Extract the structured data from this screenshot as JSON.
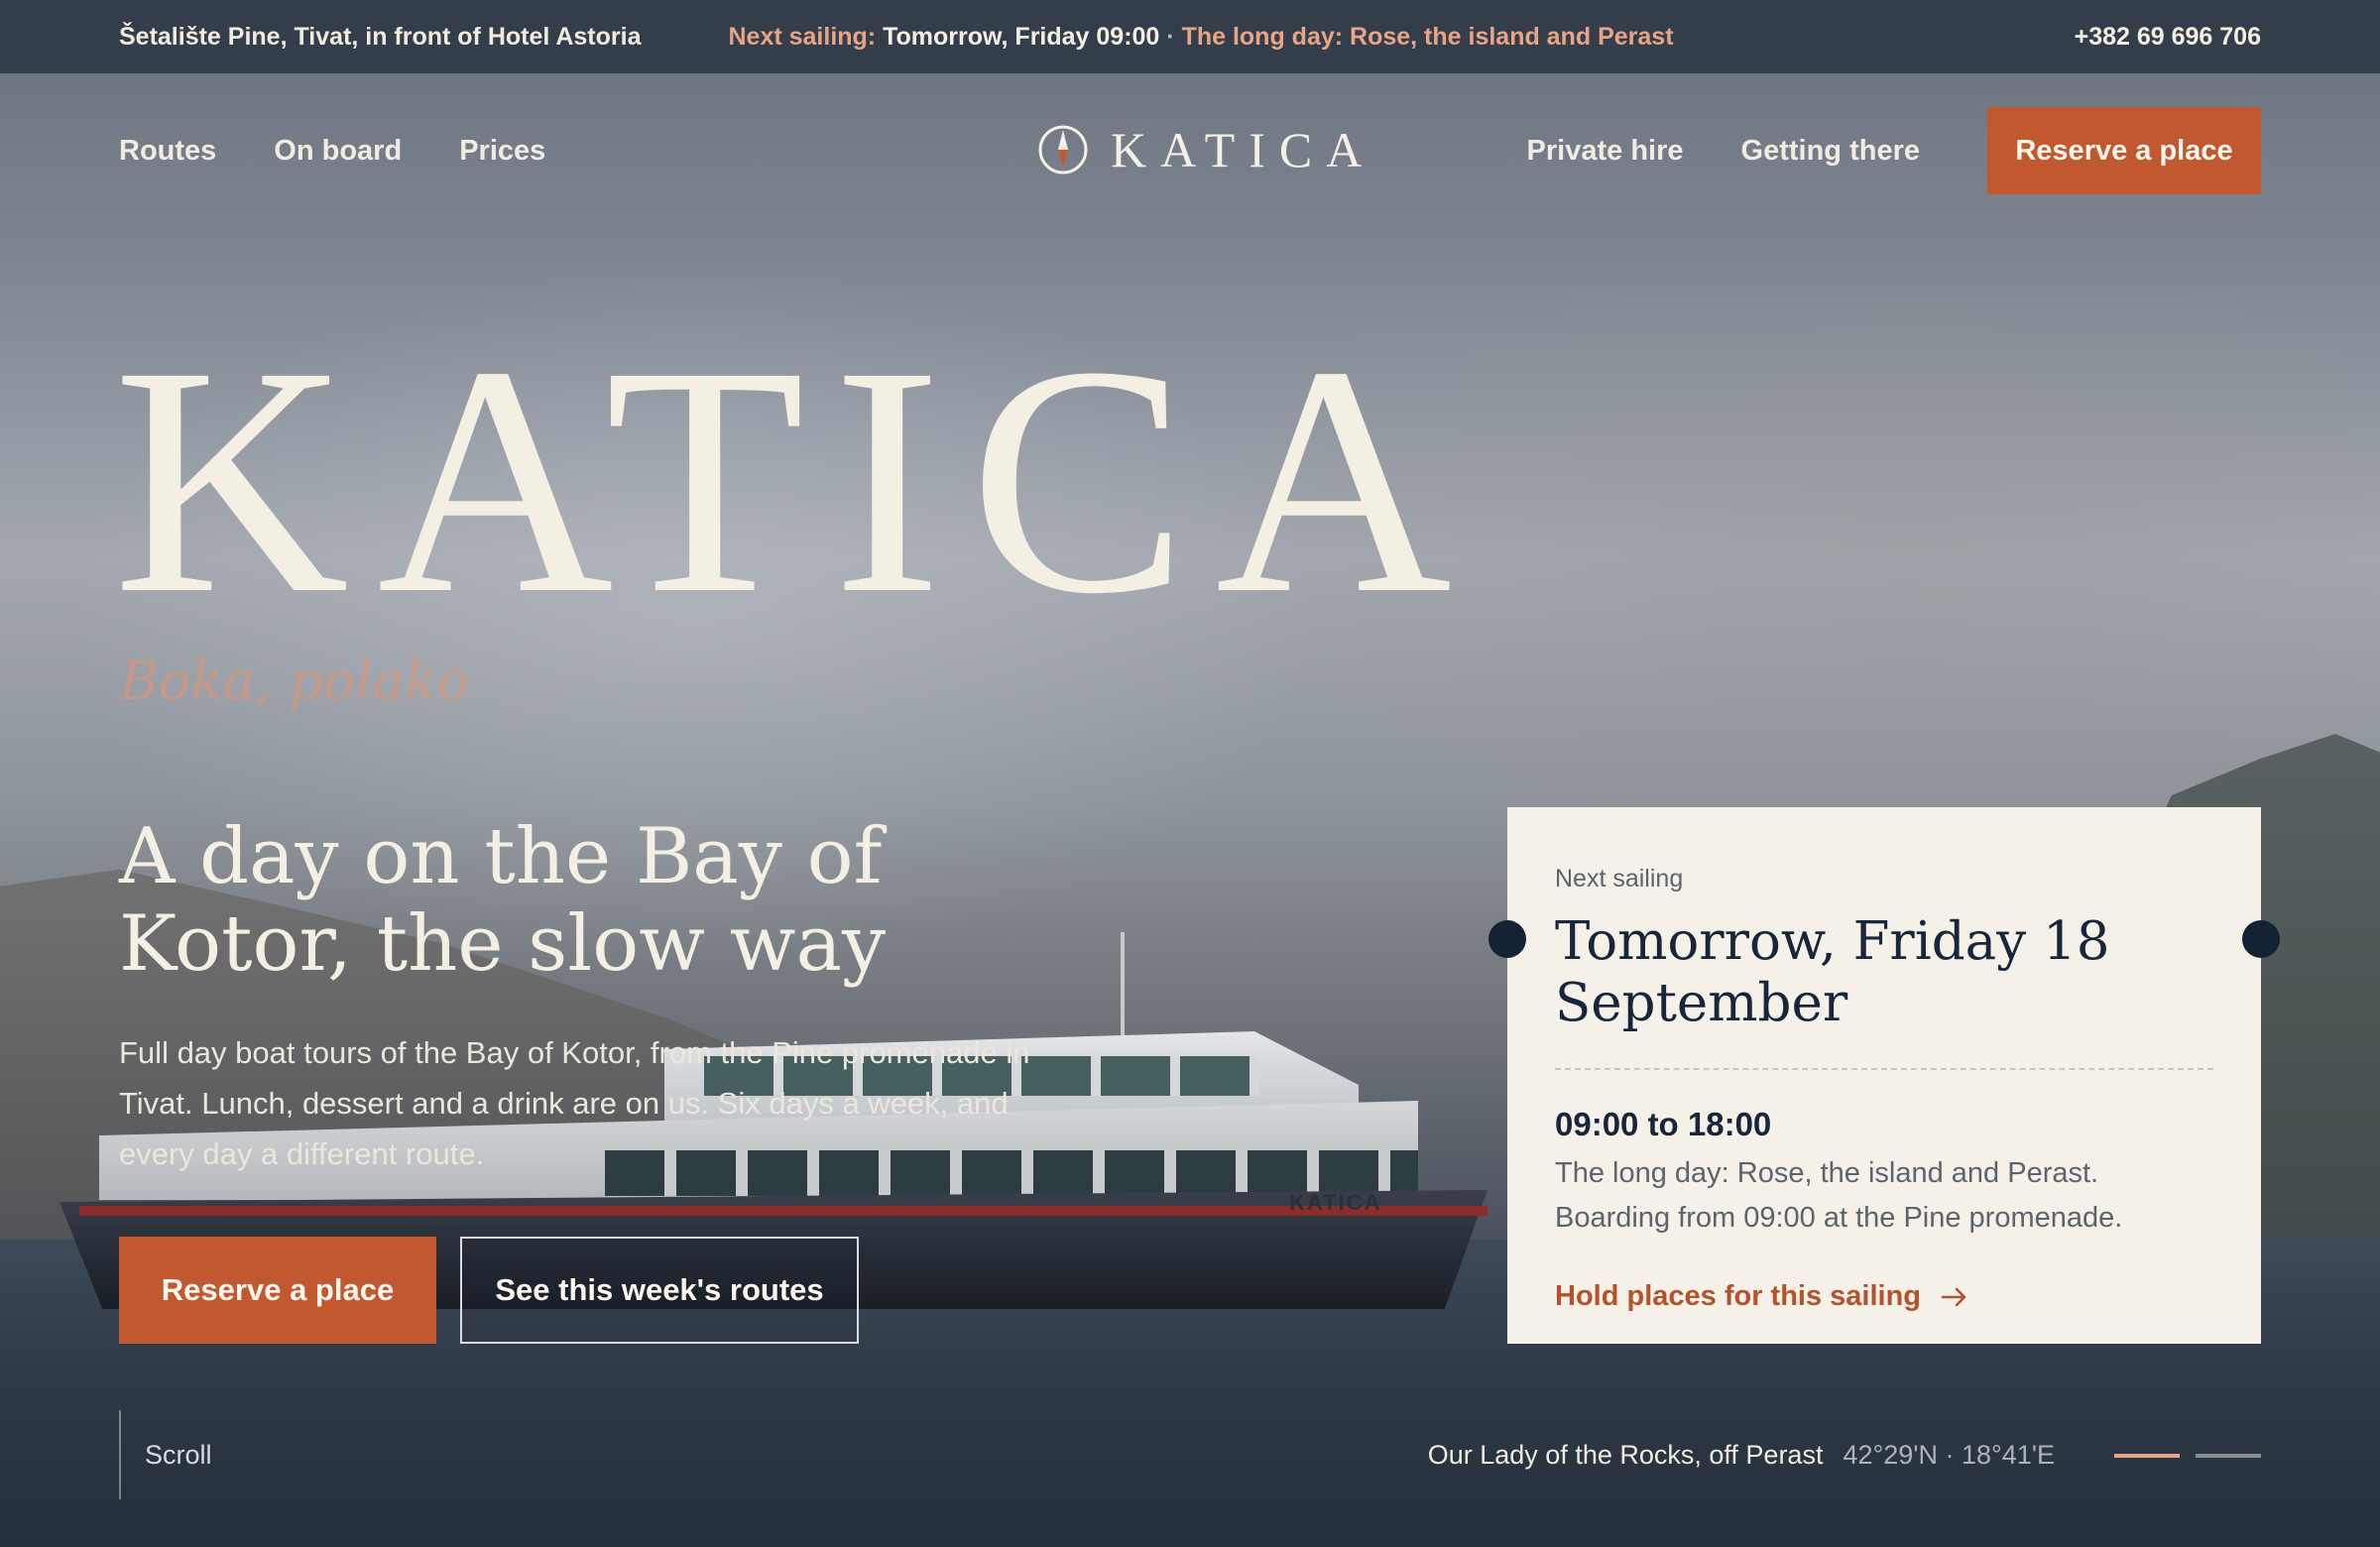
{
  "topbar": {
    "location": "Šetalište Pine, Tivat, in front of Hotel Astoria",
    "next_label": "Next sailing:",
    "next_time": "Tomorrow, Friday 09:00",
    "next_separator": "·",
    "next_route": "The long day: Rose, the island and Perast",
    "phone": "+382 69 696 706"
  },
  "nav": {
    "left": [
      "Routes",
      "On board",
      "Prices"
    ],
    "logo_text": "KATICA",
    "right": [
      "Private hire",
      "Getting there"
    ],
    "cta": "Reserve a place"
  },
  "hero": {
    "title": "KATICA",
    "tagline": "Boka, polako",
    "heading": "A day on the Bay of Kotor, the slow way",
    "description": "Full day boat tours of the Bay of Kotor, from the Pine promenade in Tivat. Lunch, dessert and a drink are on us. Six days a week, and every day a different route.",
    "primary_button": "Reserve a place",
    "secondary_button": "See this week's routes",
    "boat_name": "KATICA"
  },
  "card": {
    "label": "Next sailing",
    "date": "Tomorrow, Friday 18 September",
    "time": "09:00 to 18:00",
    "route": "The long day: Rose, the island and Perast. Boarding from 09:00 at the Pine promenade.",
    "link": "Hold places for this sailing"
  },
  "bottom": {
    "scroll_label": "Scroll",
    "photo_place": "Our Lady of the Rocks, off Perast",
    "photo_coords": "42°29'N · 18°41'E",
    "slides_total": 2,
    "slide_active": 1
  },
  "colors": {
    "accent": "#c1582f",
    "accent_light": "#e7a486",
    "topbar": "#343e4b",
    "card_bg": "#f5f1e8",
    "navy": "#17263a"
  },
  "icons": {
    "logo": "compass-icon",
    "card_link": "arrow-right-icon"
  }
}
